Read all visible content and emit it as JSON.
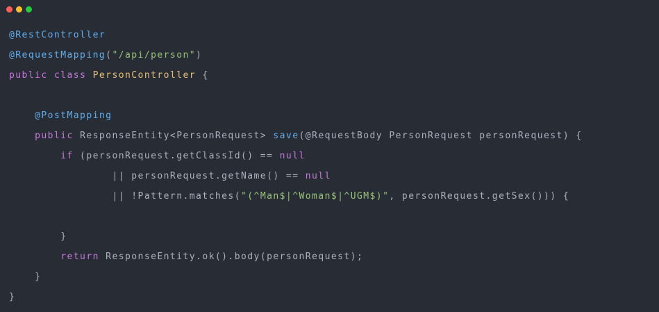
{
  "window": {
    "traffic_lights": [
      "close",
      "minimize",
      "maximize"
    ],
    "colors": {
      "background": "#282c34",
      "close": "#ff5f56",
      "minimize": "#ffbd2e",
      "maximize": "#27c93f",
      "annotation": "#61afef",
      "keyword": "#c678dd",
      "class_name": "#e5c07b",
      "string": "#98c379",
      "text": "#abb2bf"
    }
  },
  "code": {
    "l1": {
      "annot": "@RestController"
    },
    "l2": {
      "annot": "@RequestMapping",
      "open": "(",
      "str": "\"/api/person\"",
      "close": ")"
    },
    "l3": {
      "kw1": "public",
      "kw2": "class",
      "cls": "PersonController",
      "brace": "{"
    },
    "l5": {
      "indent": "    ",
      "annot": "@PostMapping"
    },
    "l6": {
      "indent": "    ",
      "kw": "public",
      "type": "ResponseEntity<PersonRequest>",
      "fn": "save",
      "args": "(@RequestBody PersonRequest personRequest) {"
    },
    "l7": {
      "indent": "        ",
      "kw": "if",
      "expr": " (personRequest.getClassId() == ",
      "null": "null"
    },
    "l8": {
      "indent": "                ",
      "expr": "|| personRequest.getName() == ",
      "null": "null"
    },
    "l9": {
      "indent": "                ",
      "expr1": "|| !Pattern.matches(",
      "str": "\"(^Man$|^Woman$|^UGM$)\"",
      "expr2": ", personRequest.getSex())) {"
    },
    "l11": {
      "indent": "        ",
      "brace": "}"
    },
    "l12": {
      "indent": "        ",
      "kw": "return",
      "expr": " ResponseEntity.ok().body(personRequest);"
    },
    "l13": {
      "indent": "    ",
      "brace": "}"
    },
    "l14": {
      "brace": "}"
    }
  }
}
